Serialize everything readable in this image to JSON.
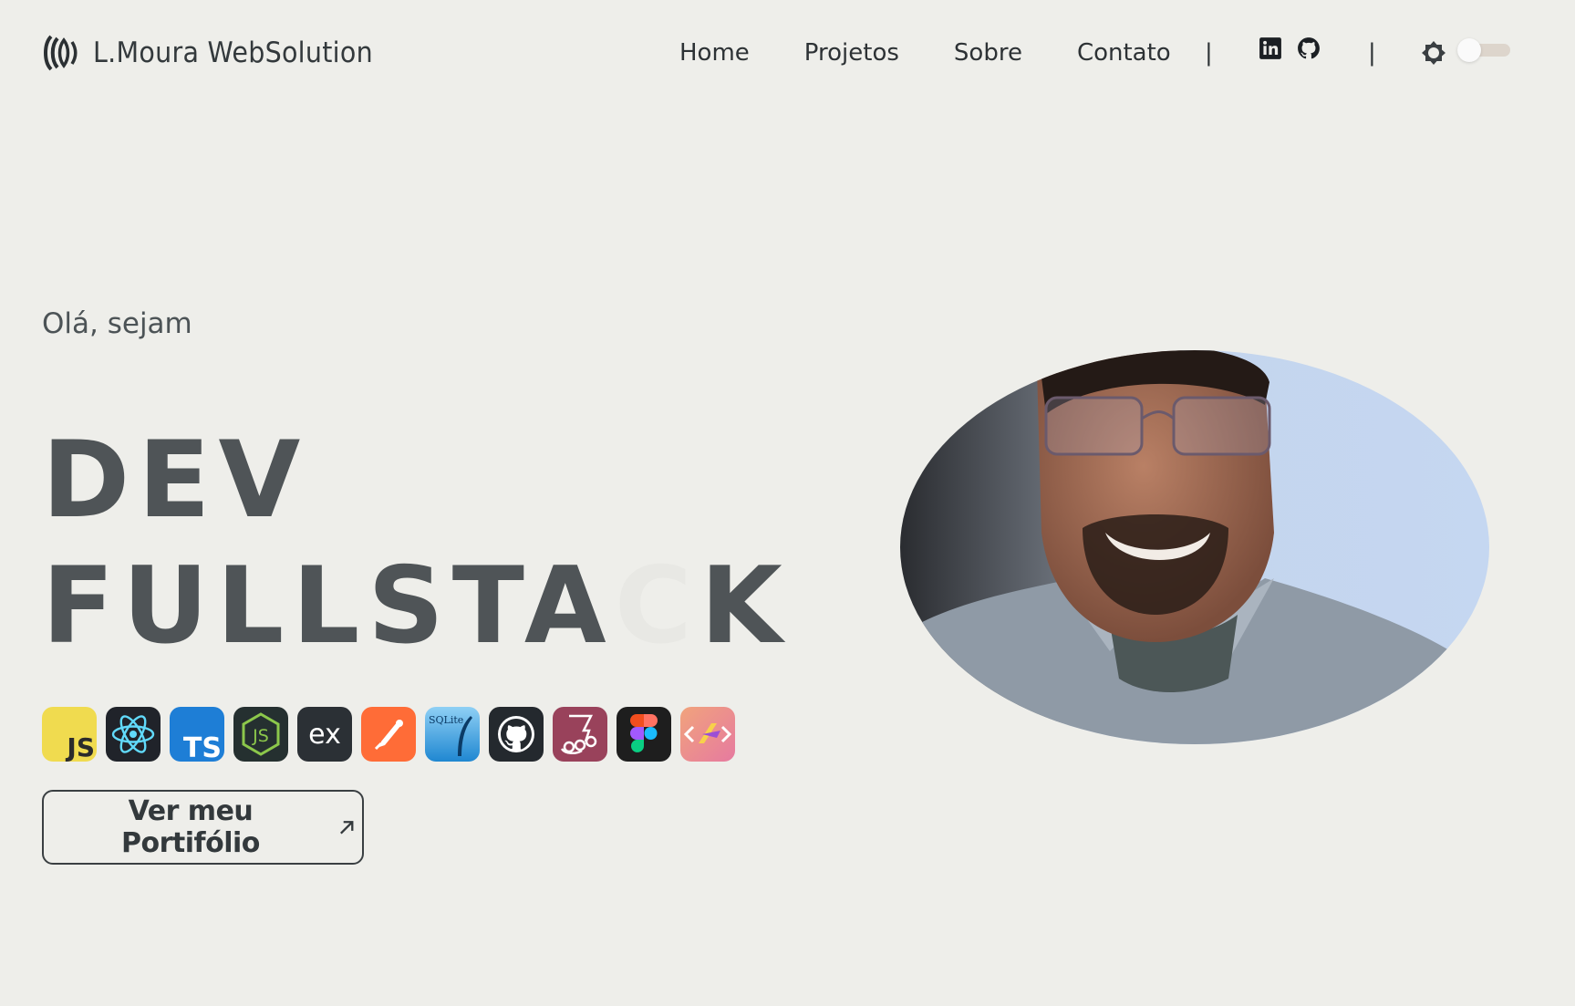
{
  "brand": {
    "name": "L.Moura WebSolution"
  },
  "nav": {
    "items": [
      "Home",
      "Projetos",
      "Sobre",
      "Contato"
    ],
    "separator": "|"
  },
  "social": [
    "linkedin-icon",
    "github-icon"
  ],
  "theme": {
    "icon": "sun-icon",
    "dark_mode": false
  },
  "hero": {
    "greeting": "Olá, sejam",
    "title_line1": "DEV",
    "title_line2_a": "FULLSTA",
    "title_line2_b": "C",
    "title_line2_c": "K",
    "cta_label": "Ver meu Portifólio"
  },
  "tech_stack": [
    {
      "name": "javascript-icon",
      "text": "JS",
      "bg": "#f0db4f"
    },
    {
      "name": "react-icon",
      "bg": "#20232a"
    },
    {
      "name": "typescript-icon",
      "text": "TS",
      "bg": "#1e7ed6"
    },
    {
      "name": "nodejs-icon",
      "bg": "#253030"
    },
    {
      "name": "express-icon",
      "text": "ex",
      "bg": "#2b3035"
    },
    {
      "name": "postman-icon",
      "bg": "#ff6c37"
    },
    {
      "name": "sqlite-icon",
      "text": "SQLite",
      "bg": "#3fa6e3"
    },
    {
      "name": "github-icon",
      "bg": "#24292e"
    },
    {
      "name": "jest-icon",
      "bg": "#99425b"
    },
    {
      "name": "figma-icon",
      "bg": "#1e1e1e"
    },
    {
      "name": "vite-icon",
      "bg": "#ee8c6e"
    }
  ],
  "colors": {
    "background": "#eeeeea",
    "title": "#4f5457",
    "text": "#2d3235"
  }
}
